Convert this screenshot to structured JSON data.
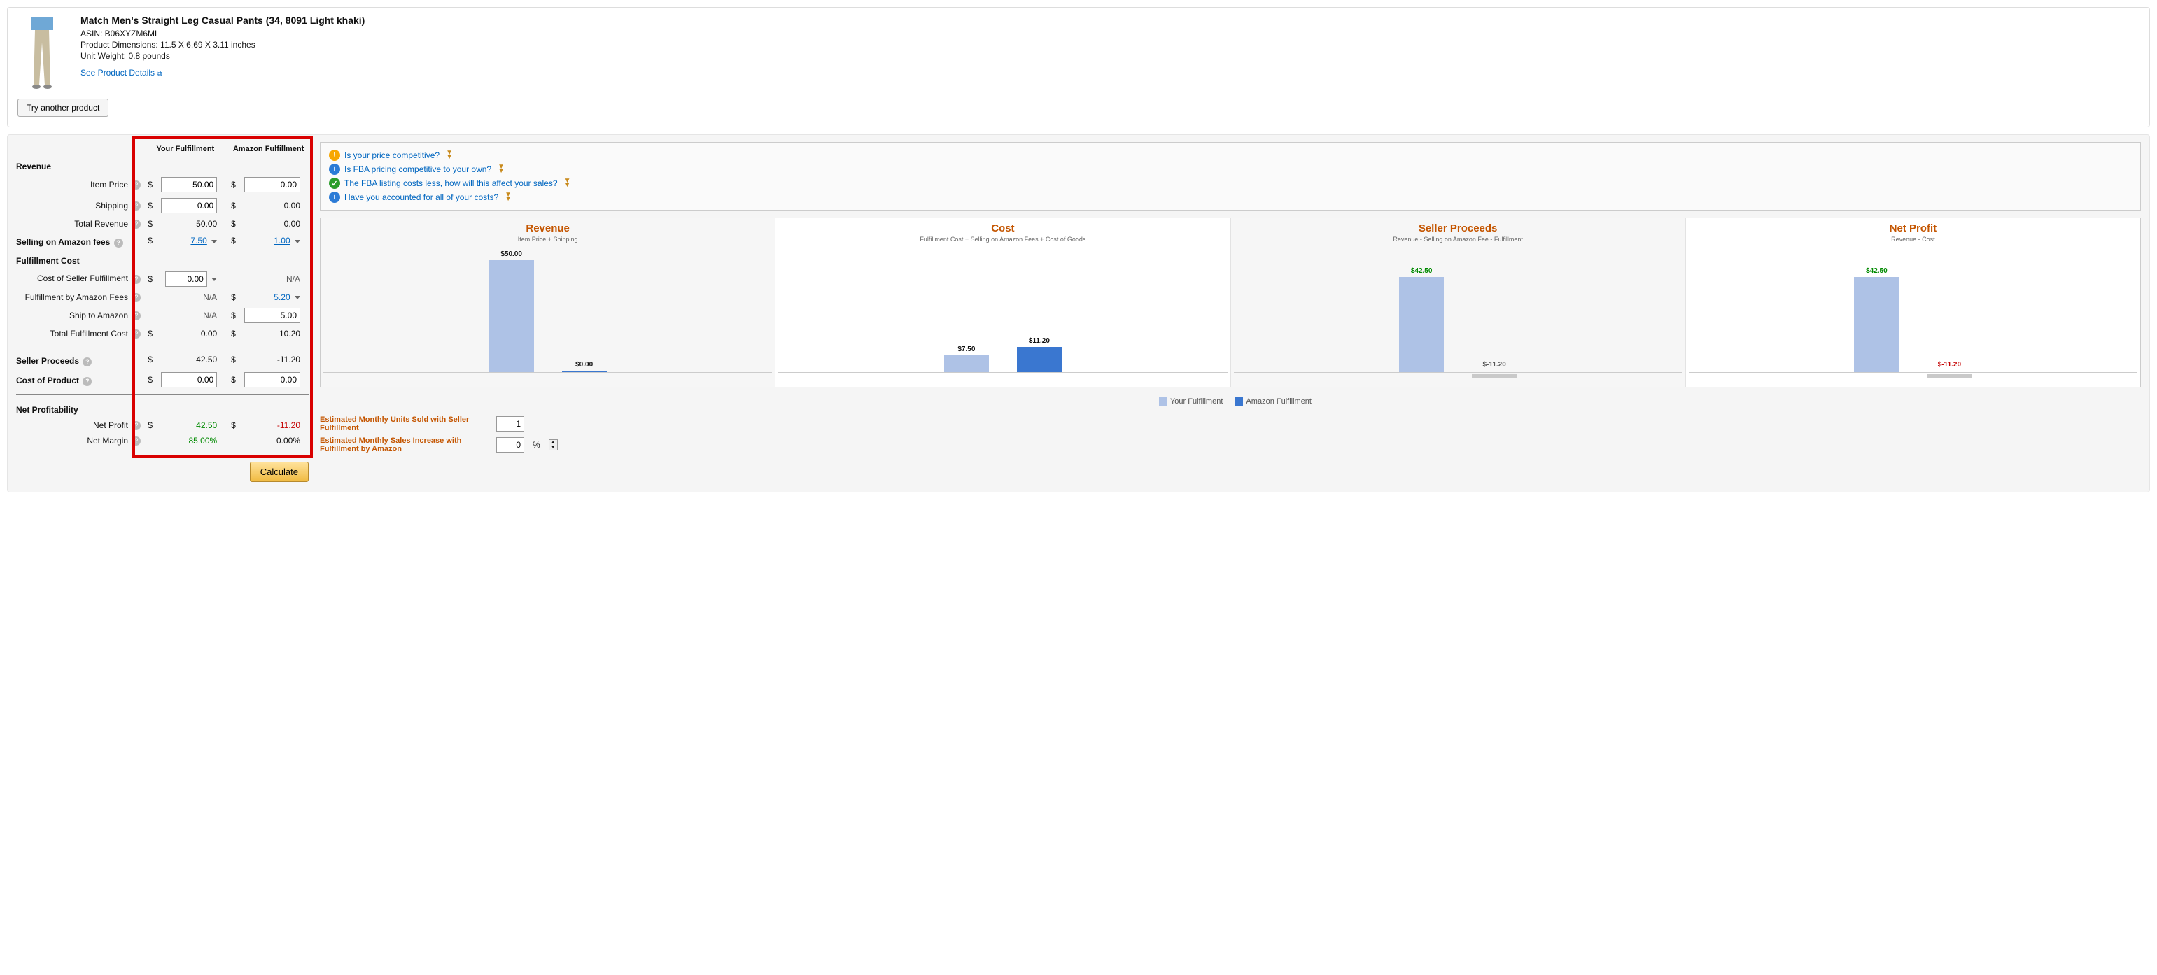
{
  "product": {
    "title": "Match Men's Straight Leg Casual Pants (34, 8091 Light khaki)",
    "asin_label": "ASIN: B06XYZM6ML",
    "dimensions": "Product Dimensions: 11.5 X 6.69 X 3.11 inches",
    "weight": "Unit Weight: 0.8 pounds",
    "details_link": "See Product Details",
    "try_another": "Try another product"
  },
  "columns": {
    "your": "Your Fulfillment",
    "amazon": "Amazon Fulfillment"
  },
  "sections": {
    "revenue": "Revenue",
    "selling_fees": "Selling on Amazon fees",
    "fulfillment_cost": "Fulfillment Cost",
    "seller_proceeds": "Seller Proceeds",
    "cost_of_product": "Cost of Product",
    "net_profitability": "Net Profitability"
  },
  "rows": {
    "item_price": "Item Price",
    "shipping": "Shipping",
    "total_revenue": "Total Revenue",
    "cost_seller_fulfillment": "Cost of Seller Fulfillment",
    "fulfillment_amazon_fees": "Fulfillment by Amazon Fees",
    "ship_to_amazon": "Ship to Amazon",
    "total_fulfillment_cost": "Total Fulfillment Cost",
    "net_profit": "Net Profit",
    "net_margin": "Net Margin"
  },
  "values": {
    "your": {
      "item_price": "50.00",
      "shipping": "0.00",
      "total_revenue": "50.00",
      "selling_fees": "7.50",
      "cost_seller_fulfillment": "0.00",
      "fulfillment_amazon_fees": "N/A",
      "ship_to_amazon": "N/A",
      "total_fulfillment_cost": "0.00",
      "seller_proceeds": "42.50",
      "cost_of_product": "0.00",
      "net_profit": "42.50",
      "net_margin": "85.00%"
    },
    "amazon": {
      "item_price": "0.00",
      "shipping": "0.00",
      "total_revenue": "0.00",
      "selling_fees": "1.00",
      "cost_seller_fulfillment": "N/A",
      "fulfillment_amazon_fees": "5.20",
      "ship_to_amazon": "5.00",
      "total_fulfillment_cost": "10.20",
      "seller_proceeds": "-11.20",
      "cost_of_product": "0.00",
      "net_profit": "-11.20",
      "net_margin": "0.00%"
    }
  },
  "calculate": "Calculate",
  "messages": [
    {
      "icon": "warn",
      "text": "Is your price competitive?"
    },
    {
      "icon": "info",
      "text": "Is FBA pricing competitive to your own?"
    },
    {
      "icon": "ok",
      "text": "The FBA listing costs less, how will this affect your sales?"
    },
    {
      "icon": "info",
      "text": "Have you accounted for all of your costs?"
    }
  ],
  "chart_data": [
    {
      "type": "bar",
      "title": "Revenue",
      "subtitle": "Item Price + Shipping",
      "series": [
        {
          "name": "Your Fulfillment",
          "value": 50.0,
          "label": "$50.00",
          "color": "#aec2e6"
        },
        {
          "name": "Amazon Fulfillment",
          "value": 0.0,
          "label": "$0.00",
          "color": "#3a77d0"
        }
      ]
    },
    {
      "type": "bar",
      "title": "Cost",
      "subtitle": "Fulfillment Cost + Selling on Amazon Fees + Cost of Goods",
      "series": [
        {
          "name": "Your Fulfillment",
          "value": 7.5,
          "label": "$7.50",
          "color": "#aec2e6"
        },
        {
          "name": "Amazon Fulfillment",
          "value": 11.2,
          "label": "$11.20",
          "color": "#3a77d0"
        }
      ]
    },
    {
      "type": "bar",
      "title": "Seller Proceeds",
      "subtitle": "Revenue - Selling on Amazon Fee - Fulfillment",
      "series": [
        {
          "name": "Your Fulfillment",
          "value": 42.5,
          "label": "$42.50",
          "color": "#aec2e6",
          "labelColor": "#008a00"
        },
        {
          "name": "Amazon Fulfillment",
          "value": -11.2,
          "label": "$-11.20",
          "color": "#9aa",
          "labelColor": "#555"
        }
      ]
    },
    {
      "type": "bar",
      "title": "Net Profit",
      "subtitle": "Revenue - Cost",
      "series": [
        {
          "name": "Your Fulfillment",
          "value": 42.5,
          "label": "$42.50",
          "color": "#aec2e6",
          "labelColor": "#008a00"
        },
        {
          "name": "Amazon Fulfillment",
          "value": -11.2,
          "label": "$-11.20",
          "color": "#9aa",
          "labelColor": "#c40000"
        }
      ]
    }
  ],
  "legend": {
    "your": "Your Fulfillment",
    "amazon": "Amazon Fulfillment"
  },
  "estimates": {
    "units_label": "Estimated Monthly Units Sold with Seller Fulfillment",
    "units_value": "1",
    "increase_label": "Estimated Monthly Sales Increase with Fulfillment by Amazon",
    "increase_value": "0",
    "pct": "%"
  },
  "colors": {
    "your": "#aec2e6",
    "amazon": "#3a77d0"
  },
  "chart_max": 50.0
}
